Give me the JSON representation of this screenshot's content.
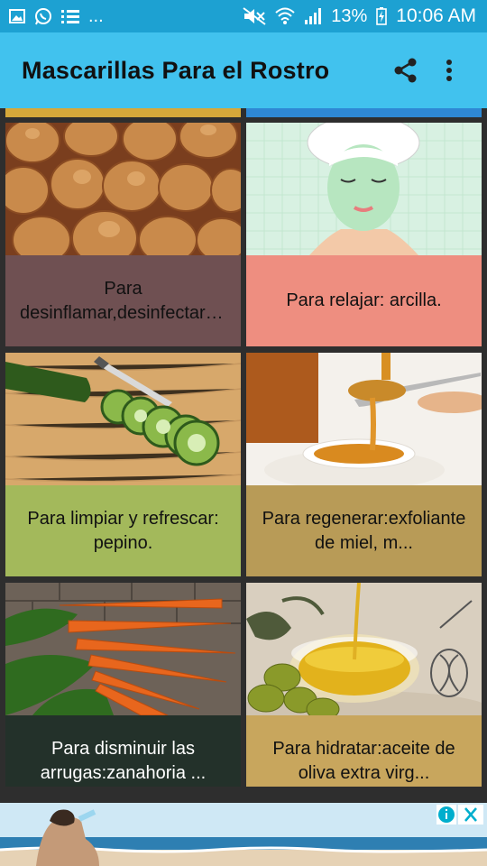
{
  "status_bar": {
    "overflow": "...",
    "battery": "13%",
    "time": "10:06 AM",
    "icons": [
      "image-icon",
      "whatsapp-icon",
      "list-icon",
      "mute-icon",
      "wifi-icon",
      "signal-icon",
      "battery-icon"
    ]
  },
  "app_bar": {
    "title": "Mascarillas Para el Rostro",
    "actions": [
      "share-icon",
      "more-vert-icon"
    ]
  },
  "cards": [
    {
      "caption": "Para desinflamar,desinfectar:cebolla ...",
      "image": "onions",
      "caption_color": "#6f5052"
    },
    {
      "caption": "Para relajar: arcilla.",
      "image": "face-mask",
      "caption_color": "#ee8e80"
    },
    {
      "caption": "Para limpiar y refrescar: pepino.",
      "image": "cucumber",
      "caption_color": "#a3b95b"
    },
    {
      "caption": "Para regenerar:exfoliante de miel, m...",
      "image": "honey",
      "caption_color": "#b89b57"
    },
    {
      "caption": "Para disminuir las arrugas:zanahoria ...",
      "image": "carrots",
      "caption_color": "#23312a"
    },
    {
      "caption": "Para hidratar:aceite de oliva extra virg...",
      "image": "olive-oil",
      "caption_color": "#c8a65d"
    }
  ],
  "ad_banner": {
    "icons": [
      "ad-info-icon",
      "ad-close-icon"
    ]
  }
}
